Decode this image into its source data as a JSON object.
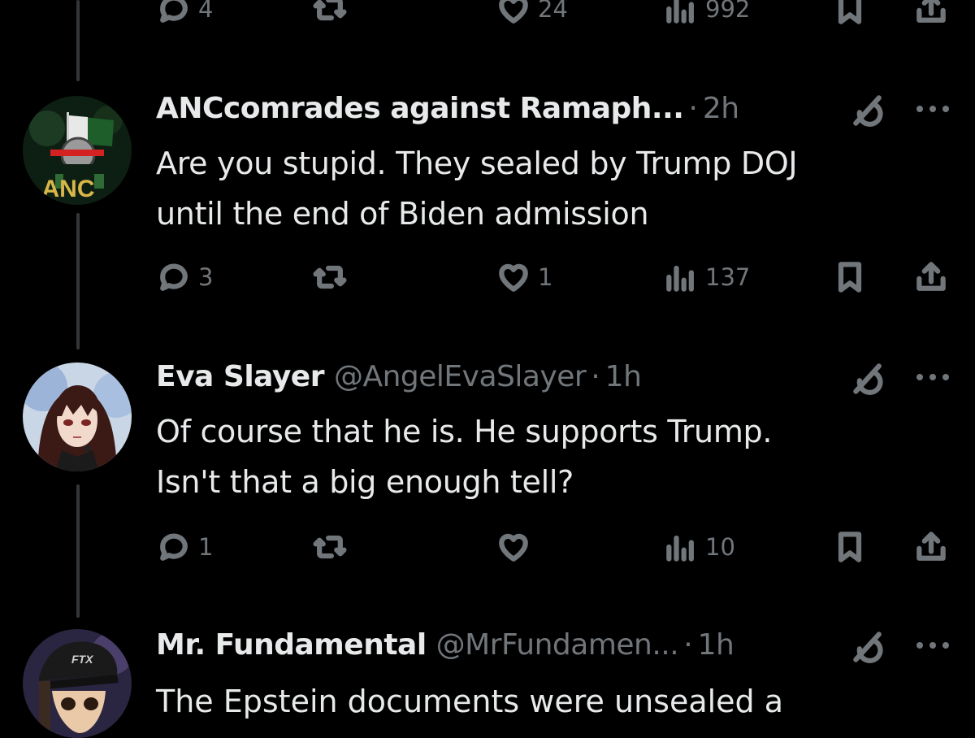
{
  "colors": {
    "background": "#000000",
    "text": "#e7e9ea",
    "muted": "#71767b",
    "thread_line": "#333639"
  },
  "top_actions": {
    "replies": "4",
    "retweets": "",
    "likes": "24",
    "views": "992"
  },
  "posts": [
    {
      "name": "ANCcomrades against Ramaph...",
      "handle": "",
      "separator": "·",
      "time": "2h",
      "avatar_text": "ANC",
      "text": "Are you stupid. They sealed by Trump DOJ\nuntil the end of  Biden admission",
      "actions": {
        "replies": "3",
        "retweets": "",
        "likes": "1",
        "views": "137"
      }
    },
    {
      "name": "Eva Slayer",
      "handle": "@AngelEvaSlayer",
      "separator": "·",
      "time": "1h",
      "text": "Of course that he is. He supports Trump.\nIsn't that a big enough tell?",
      "actions": {
        "replies": "1",
        "retweets": "",
        "likes": "",
        "views": "10"
      }
    },
    {
      "name": "Mr. Fundamental",
      "handle": "@MrFundamen...",
      "separator": "·",
      "time": "1h",
      "avatar_text": "FTX",
      "text": "The Epstein documents were unsealed a"
    }
  ],
  "icons": [
    "reply-icon",
    "retweet-icon",
    "like-icon",
    "views-icon",
    "bookmark-icon",
    "share-icon",
    "grok-icon",
    "more-icon"
  ]
}
